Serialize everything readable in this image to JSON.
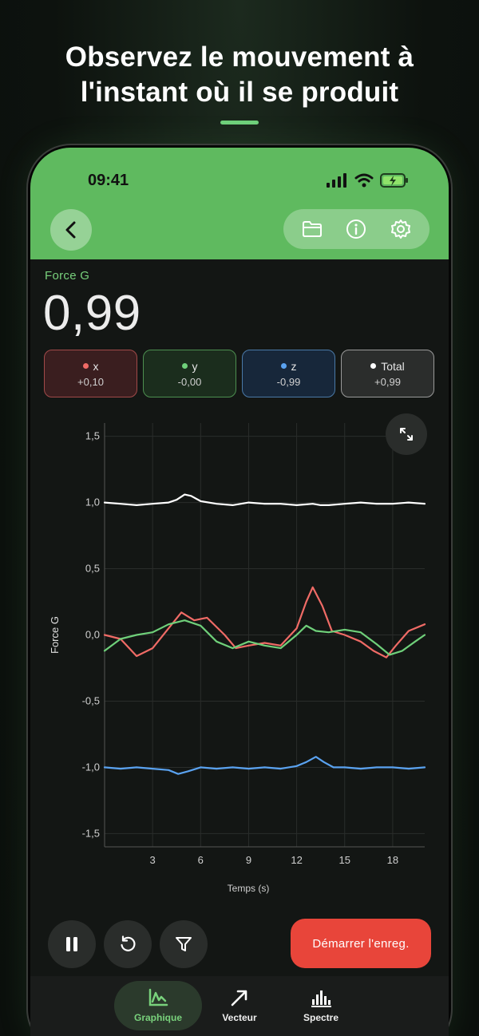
{
  "headline": {
    "line1": "Observez le mouvement à",
    "line2": "l'instant où il se produit"
  },
  "status_bar": {
    "time": "09:41",
    "icons": [
      "signal-icon",
      "wifi-icon",
      "battery-charging-icon"
    ]
  },
  "toolbar": {
    "back_icon": "chevron-left-icon",
    "actions": [
      "folder-icon",
      "info-icon",
      "settings-gear-icon"
    ]
  },
  "metric": {
    "label": "Force G",
    "value": "0,99"
  },
  "chips": [
    {
      "name": "x",
      "value": "+0,10",
      "color": "#f06b66"
    },
    {
      "name": "y",
      "value": "-0,00",
      "color": "#6fd07a"
    },
    {
      "name": "z",
      "value": "-0,99",
      "color": "#5aa2f0"
    },
    {
      "name": "Total",
      "value": "+0,99",
      "color": "#ffffff"
    }
  ],
  "chart_data": {
    "type": "line",
    "xlabel": "Temps (s)",
    "ylabel": "Force G",
    "xlim": [
      0,
      20
    ],
    "ylim": [
      -1.6,
      1.6
    ],
    "xticks": [
      3,
      6,
      9,
      12,
      15,
      18
    ],
    "xtick_labels": [
      "3",
      "6",
      "9",
      "12",
      "15",
      "18"
    ],
    "yticks": [
      1.5,
      1.0,
      0.5,
      0.0,
      -0.5,
      -1.0,
      -1.5
    ],
    "ytick_labels": [
      "1,5",
      "1,0",
      "0,5",
      "0,0",
      "-0,5",
      "-1,0",
      "-1,5"
    ],
    "grid": true,
    "series": [
      {
        "name": "Total",
        "color": "#ffffff",
        "x": [
          0,
          1,
          2,
          3,
          4,
          4.5,
          5,
          5.4,
          6,
          7,
          8,
          9,
          10,
          11,
          12,
          13,
          13.5,
          14,
          15,
          16,
          17,
          18,
          19,
          20
        ],
        "y": [
          1.0,
          0.99,
          0.98,
          0.99,
          1.0,
          1.02,
          1.06,
          1.05,
          1.01,
          0.99,
          0.98,
          1.0,
          0.99,
          0.99,
          0.98,
          0.99,
          0.98,
          0.98,
          0.99,
          1.0,
          0.99,
          0.99,
          1.0,
          0.99
        ]
      },
      {
        "name": "x",
        "color": "#f06b66",
        "x": [
          0,
          1,
          2,
          3,
          4,
          4.8,
          5.6,
          6.4,
          7.5,
          8.2,
          9,
          10,
          11,
          12,
          12.6,
          13,
          13.6,
          14.2,
          15,
          16,
          16.8,
          17.6,
          18.2,
          19,
          20
        ],
        "y": [
          0.0,
          -0.03,
          -0.16,
          -0.1,
          0.05,
          0.17,
          0.11,
          0.13,
          0.0,
          -0.1,
          -0.08,
          -0.06,
          -0.08,
          0.05,
          0.25,
          0.36,
          0.22,
          0.03,
          0.0,
          -0.05,
          -0.12,
          -0.17,
          -0.08,
          0.03,
          0.08
        ]
      },
      {
        "name": "y",
        "color": "#6fd07a",
        "x": [
          0,
          1,
          2,
          3,
          4,
          5,
          6,
          7,
          8,
          9,
          10,
          11,
          12,
          12.6,
          13.2,
          14,
          15,
          16,
          17,
          17.8,
          18.6,
          19.4,
          20
        ],
        "y": [
          -0.12,
          -0.03,
          0.0,
          0.02,
          0.08,
          0.11,
          0.07,
          -0.05,
          -0.1,
          -0.05,
          -0.08,
          -0.1,
          0.0,
          0.07,
          0.03,
          0.02,
          0.04,
          0.02,
          -0.07,
          -0.15,
          -0.12,
          -0.05,
          0.0
        ]
      },
      {
        "name": "z",
        "color": "#5aa2f0",
        "x": [
          0,
          1,
          2,
          3,
          4,
          4.6,
          5.2,
          6,
          7,
          8,
          9,
          10,
          11,
          12,
          12.6,
          13.2,
          13.7,
          14.3,
          15,
          16,
          17,
          18,
          19,
          20
        ],
        "y": [
          -1.0,
          -1.01,
          -1.0,
          -1.01,
          -1.02,
          -1.05,
          -1.03,
          -1.0,
          -1.01,
          -1.0,
          -1.01,
          -1.0,
          -1.01,
          -0.99,
          -0.96,
          -0.92,
          -0.96,
          -1.0,
          -1.0,
          -1.01,
          -1.0,
          -1.0,
          -1.01,
          -1.0
        ]
      }
    ]
  },
  "controls": {
    "pause_icon": "pause-icon",
    "reset_icon": "reset-icon",
    "filter_icon": "filter-icon",
    "record_label": "Démarrer l'enreg."
  },
  "tabs": [
    {
      "label": "Graphique",
      "icon": "graph-icon",
      "active": true
    },
    {
      "label": "Vecteur",
      "icon": "vector-arrow-icon",
      "active": false
    },
    {
      "label": "Spectre",
      "icon": "spectrum-icon",
      "active": false
    }
  ]
}
